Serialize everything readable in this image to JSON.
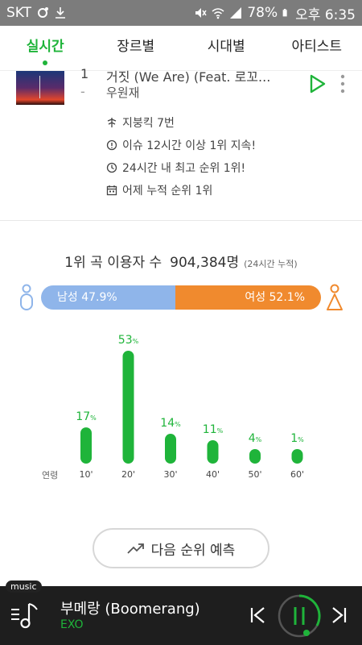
{
  "statusbar": {
    "carrier": "SKT",
    "battery": "78%",
    "time": "오후 6:35"
  },
  "tabs": [
    {
      "label": "실시간",
      "active": true
    },
    {
      "label": "장르별",
      "active": false
    },
    {
      "label": "시대별",
      "active": false
    },
    {
      "label": "아티스트",
      "active": false
    }
  ],
  "song": {
    "rank": "1",
    "change": "-",
    "title": "거짓 (We Are) (Feat. 로꼬...",
    "artist": "우원재",
    "info": [
      {
        "icon": "crown-icon",
        "text": "지붕킥 7번"
      },
      {
        "icon": "clock-alert-icon",
        "text": "이슈 12시간 이상 1위 지속!"
      },
      {
        "icon": "clock-icon",
        "text": "24시간 내 최고 순위 1위!"
      },
      {
        "icon": "calendar-icon",
        "text": "어제 누적 순위 1위"
      }
    ]
  },
  "stats": {
    "listeners_label": "1위 곡 이용자 수",
    "listeners_count": "904,384명",
    "listeners_note": "(24시간 누적)",
    "male_label": "남성 47.9%",
    "female_label": "여성 52.1%",
    "male_ratio": 47.9,
    "colors": {
      "accent": "#1fb43a",
      "male": "#8fb5ea",
      "female": "#f08a2e"
    }
  },
  "chart_data": {
    "type": "bar",
    "xlabel": "연령",
    "categories": [
      "10'",
      "20'",
      "30'",
      "40'",
      "50'",
      "60'"
    ],
    "values": [
      17,
      53,
      14,
      11,
      4,
      1
    ],
    "value_unit": "%",
    "ylim": [
      0,
      53
    ]
  },
  "predict_button": {
    "label": "다음 순위 예측"
  },
  "player": {
    "tag": "music",
    "title": "부메랑 (Boomerang)",
    "artist": "EXO"
  }
}
